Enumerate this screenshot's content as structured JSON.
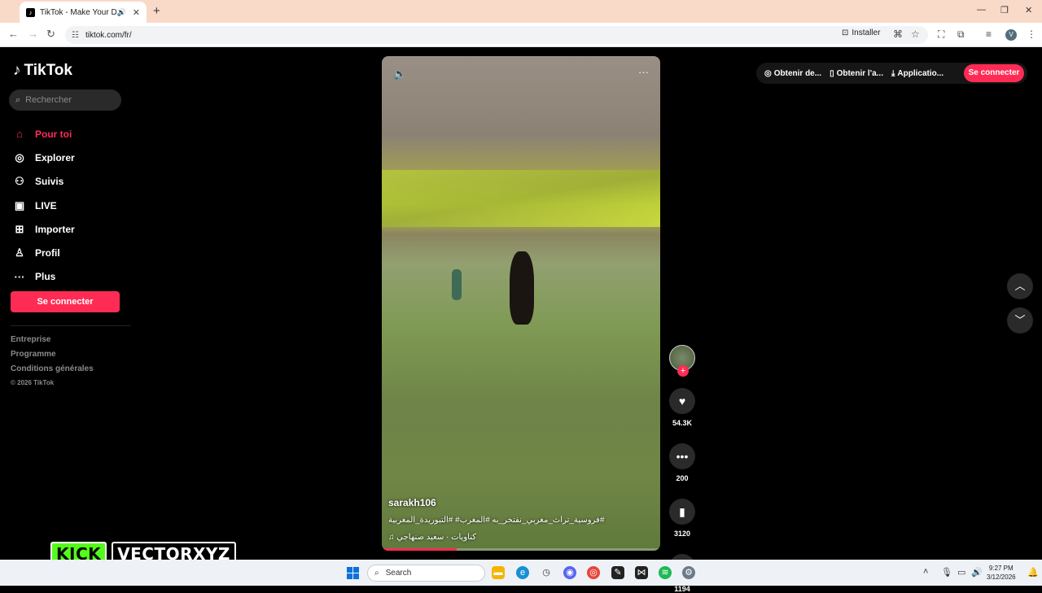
{
  "browser": {
    "tab_title": "TikTok - Make Your Day",
    "url": "tiktok.com/fr/",
    "install_label": "Installer"
  },
  "sidebar": {
    "logo_text": "TikTok",
    "search_placeholder": "Rechercher",
    "items": [
      {
        "label": "Pour toi",
        "icon": "home-icon",
        "active": true
      },
      {
        "label": "Explorer",
        "icon": "compass-icon"
      },
      {
        "label": "Suivis",
        "icon": "following-icon"
      },
      {
        "label": "LIVE",
        "icon": "live-icon"
      },
      {
        "label": "Importer",
        "icon": "upload-icon"
      },
      {
        "label": "Profil",
        "icon": "profile-icon"
      },
      {
        "label": "Plus",
        "icon": "more-icon"
      }
    ],
    "connect_label": "Se connecter",
    "footer": [
      "Entreprise",
      "Programme",
      "Conditions générales"
    ],
    "copyright": "© 2026 TikTok"
  },
  "overlay": {
    "kick": "KICK",
    "streamer": "VECTORXYZ"
  },
  "topright": {
    "item1": "Obtenir de...",
    "item2": "Obtenir l'a...",
    "item3": "Applicatio...",
    "connect_label": "Se connecter"
  },
  "video": {
    "author": "sarakh106",
    "description": "#فروسية_تراث_مغربي_نفتخر_به #المغرب# #التبوريدة_المغربية",
    "music": "كناويات · سعيد صنهاجي",
    "progress": 0.27
  },
  "actions": {
    "likes": "54.3K",
    "comments": "200",
    "saves": "3120",
    "shares": "1194"
  },
  "taskbar": {
    "search_label": "Search",
    "time": "9:27 PM",
    "date": "3/12/2026",
    "badge": "99+"
  },
  "colors": {
    "accent": "#fe2c55",
    "tab_bar": "#f9d9c8",
    "kick_green": "#53fc18"
  }
}
